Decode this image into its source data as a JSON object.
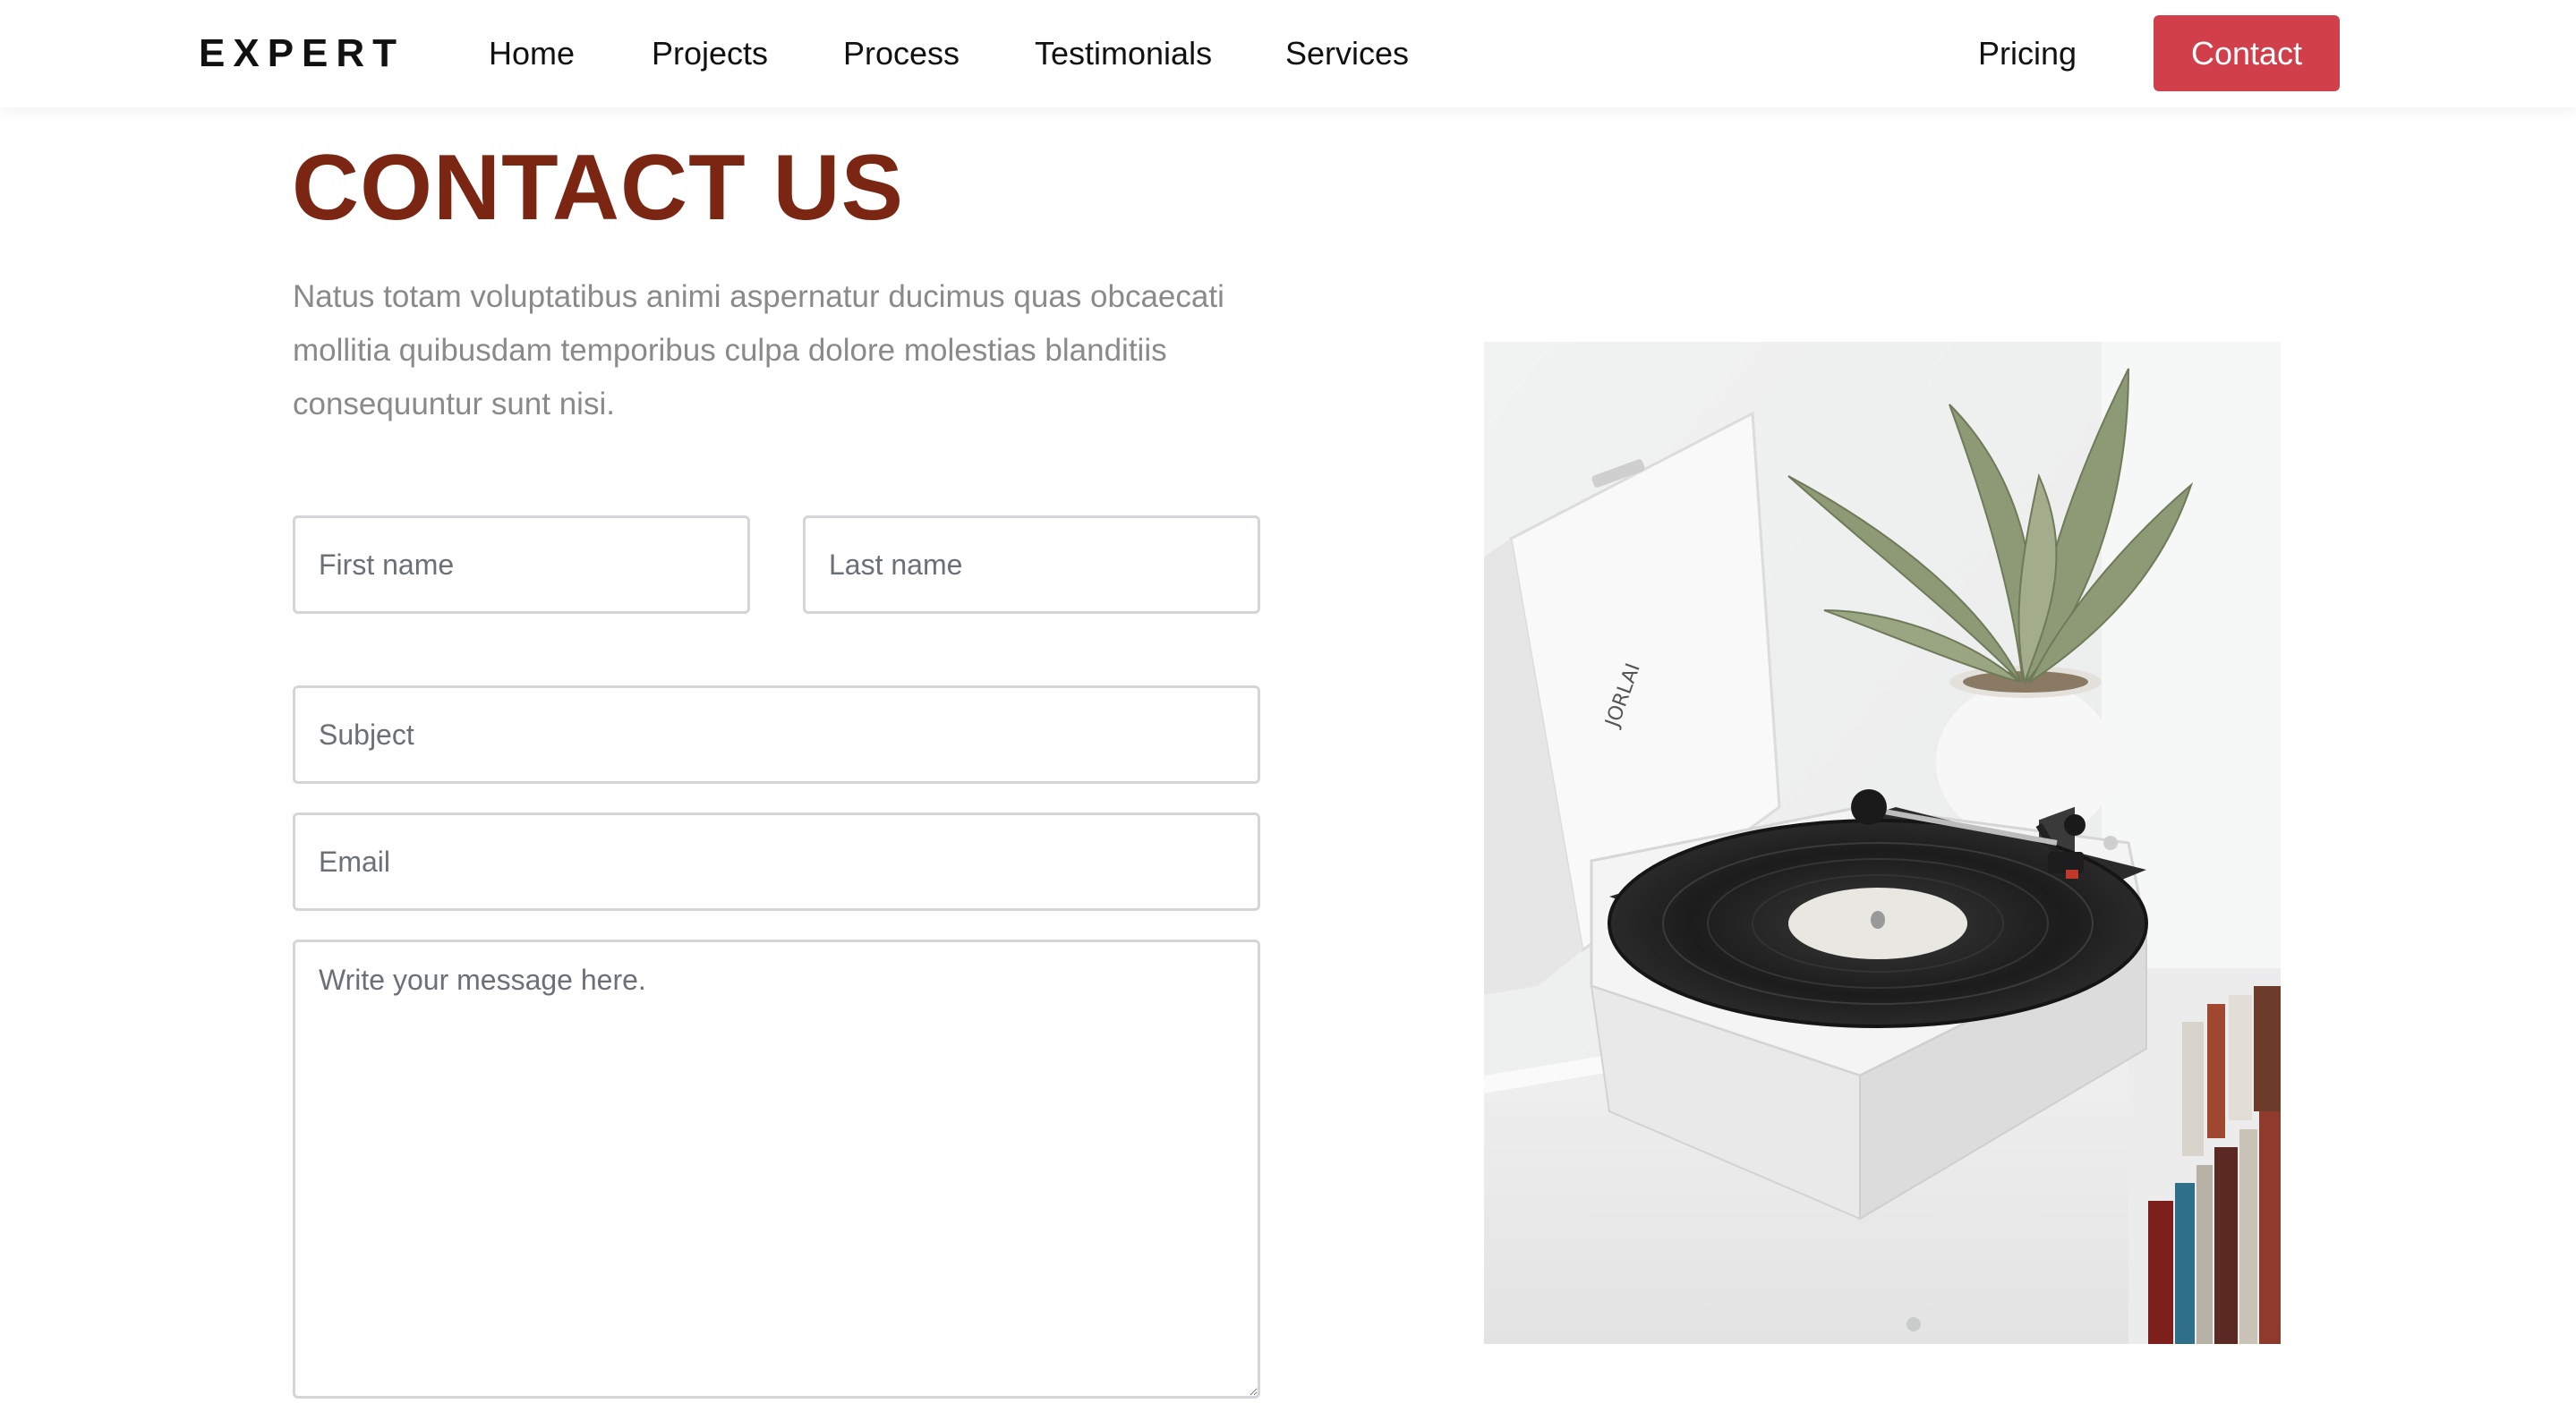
{
  "brand": "EXPERT",
  "nav": {
    "home": "Home",
    "projects": "Projects",
    "process": "Process",
    "testimonials": "Testimonials",
    "services": "Services",
    "pricing": "Pricing",
    "contact": "Contact"
  },
  "accent_color": "#d1404a",
  "title_color": "#7a2613",
  "hero": {
    "title": "CONTACT US",
    "intro": "Natus totam voluptatibus animi aspernatur ducimus quas obcaecati mollitia quibusdam temporibus culpa dolore molestias blanditiis consequuntur sunt nisi."
  },
  "form": {
    "first_name_placeholder": "First name",
    "last_name_placeholder": "Last name",
    "subject_placeholder": "Subject",
    "email_placeholder": "Email",
    "message_placeholder": "Write your message here."
  },
  "photo": {
    "lid_text": "JORLAI"
  }
}
